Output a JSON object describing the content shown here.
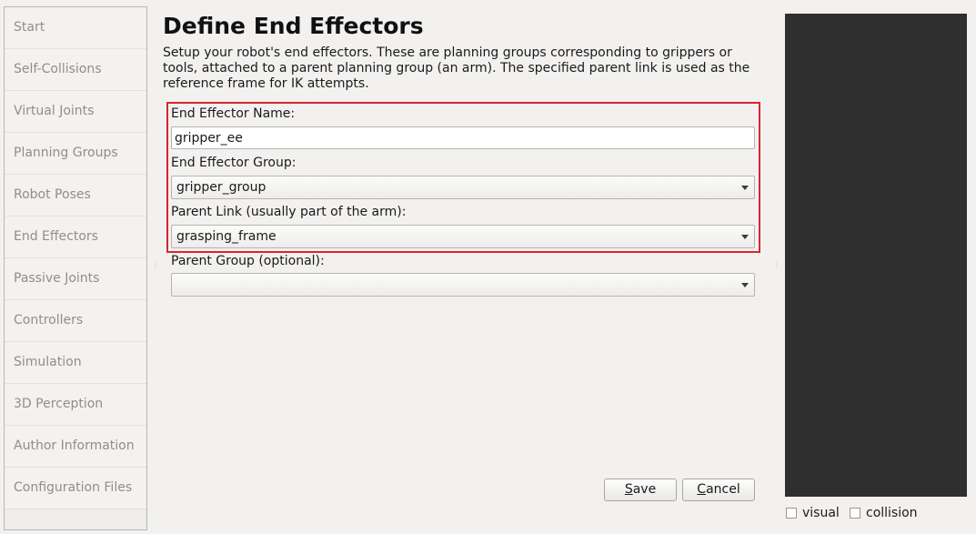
{
  "sidebar": {
    "items": [
      {
        "label": "Start"
      },
      {
        "label": "Self-Collisions"
      },
      {
        "label": "Virtual Joints"
      },
      {
        "label": "Planning Groups"
      },
      {
        "label": "Robot Poses"
      },
      {
        "label": "End Effectors"
      },
      {
        "label": "Passive Joints"
      },
      {
        "label": "Controllers"
      },
      {
        "label": "Simulation"
      },
      {
        "label": "3D Perception"
      },
      {
        "label": "Author Information"
      },
      {
        "label": "Configuration Files"
      }
    ]
  },
  "main": {
    "title": "Define End Effectors",
    "description": "Setup your robot's end effectors. These are planning groups corresponding to grippers or tools, attached to a parent planning group (an arm). The specified parent link is used as the reference frame for IK attempts.",
    "form": {
      "name_label": "End Effector Name:",
      "name_value": "gripper_ee",
      "group_label": "End Effector Group:",
      "group_value": "gripper_group",
      "parent_link_label": "Parent Link (usually part of the arm):",
      "parent_link_value": "grasping_frame",
      "parent_group_label": "Parent Group (optional):",
      "parent_group_value": ""
    },
    "buttons": {
      "save_mnemonic": "S",
      "save_rest": "ave",
      "cancel_mnemonic": "C",
      "cancel_rest": "ancel"
    }
  },
  "viewer": {
    "visual_label": "visual",
    "collision_label": "collision"
  },
  "colors": {
    "highlight_border": "#d7262e",
    "viewer_background": "#2f2f2f"
  }
}
